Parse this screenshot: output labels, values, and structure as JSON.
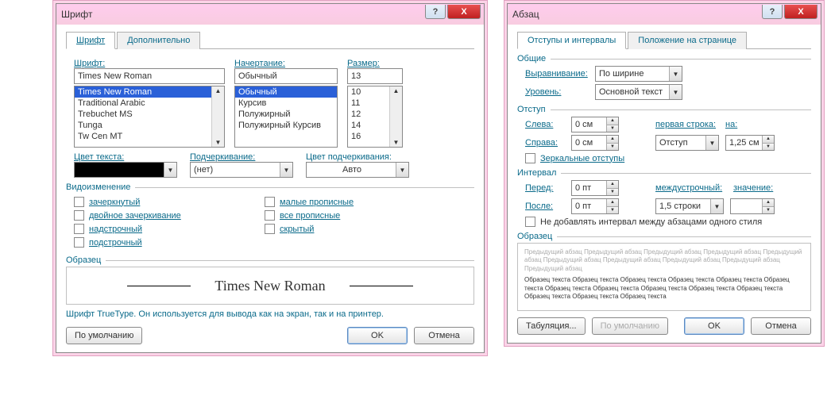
{
  "font_dialog": {
    "title": "Шрифт",
    "tabs": {
      "font": "Шрифт",
      "advanced": "Дополнительно"
    },
    "labels": {
      "font": "Шрифт:",
      "style": "Начертание:",
      "size": "Размер:",
      "text_color": "Цвет текста:",
      "underline": "Подчеркивание:",
      "underline_color": "Цвет подчеркивания:",
      "effects": "Видоизменение",
      "sample": "Образец"
    },
    "font_value": "Times New Roman",
    "font_list": [
      "Times New Roman",
      "Traditional Arabic",
      "Trebuchet MS",
      "Tunga",
      "Tw Cen MT"
    ],
    "style_value": "Обычный",
    "style_list": [
      "Обычный",
      "Курсив",
      "Полужирный",
      "Полужирный Курсив"
    ],
    "size_value": "13",
    "size_list": [
      "10",
      "11",
      "12",
      "14",
      "16"
    ],
    "underline_value": "(нет)",
    "underline_color_value": "Авто",
    "effects": {
      "strike": "зачеркнутый",
      "dstrike": "двойное зачеркивание",
      "sup": "надстрочный",
      "sub": "подстрочный",
      "smallcaps": "малые прописные",
      "allcaps": "все прописные",
      "hidden": "скрытый"
    },
    "sample_text": "Times New Roman",
    "note": "Шрифт TrueType. Он используется для вывода как на экран, так и на принтер.",
    "buttons": {
      "default": "По умолчанию",
      "ok": "OK",
      "cancel": "Отмена"
    }
  },
  "para_dialog": {
    "title": "Абзац",
    "tabs": {
      "indents": "Отступы и интервалы",
      "position": "Положение на странице"
    },
    "groups": {
      "general": "Общие",
      "indent": "Отступ",
      "spacing": "Интервал",
      "sample": "Образец"
    },
    "labels": {
      "align": "Выравнивание:",
      "level": "Уровень:",
      "left": "Слева:",
      "right": "Справа:",
      "mirror": "Зеркальные отступы",
      "first_line": "первая строка:",
      "by": "на:",
      "before": "Перед:",
      "after": "После:",
      "line_spacing": "междустрочный:",
      "value": "значение:",
      "no_space": "Не добавлять интервал между абзацами одного стиля"
    },
    "values": {
      "align": "По ширине",
      "level": "Основной текст",
      "left": "0 см",
      "right": "0 см",
      "first_line": "Отступ",
      "by": "1,25 см",
      "before": "0 пт",
      "after": "0 пт",
      "line_spacing": "1,5 строки",
      "value": ""
    },
    "sample_grey": "Предыдущий абзац Предыдущий абзац Предыдущий абзац Предыдущий абзац Предыдущий абзац Предыдущий абзац Предыдущий абзац Предыдущий абзац Предыдущий абзац Предыдущий абзац",
    "sample_bold": "Образец текста Образец текста Образец текста Образец текста Образец текста Образец текста Образец текста Образец текста Образец текста Образец текста Образец текста Образец текста Образец текста Образец текста",
    "buttons": {
      "tabs": "Табуляция...",
      "default": "По умолчанию",
      "ok": "OK",
      "cancel": "Отмена"
    }
  }
}
